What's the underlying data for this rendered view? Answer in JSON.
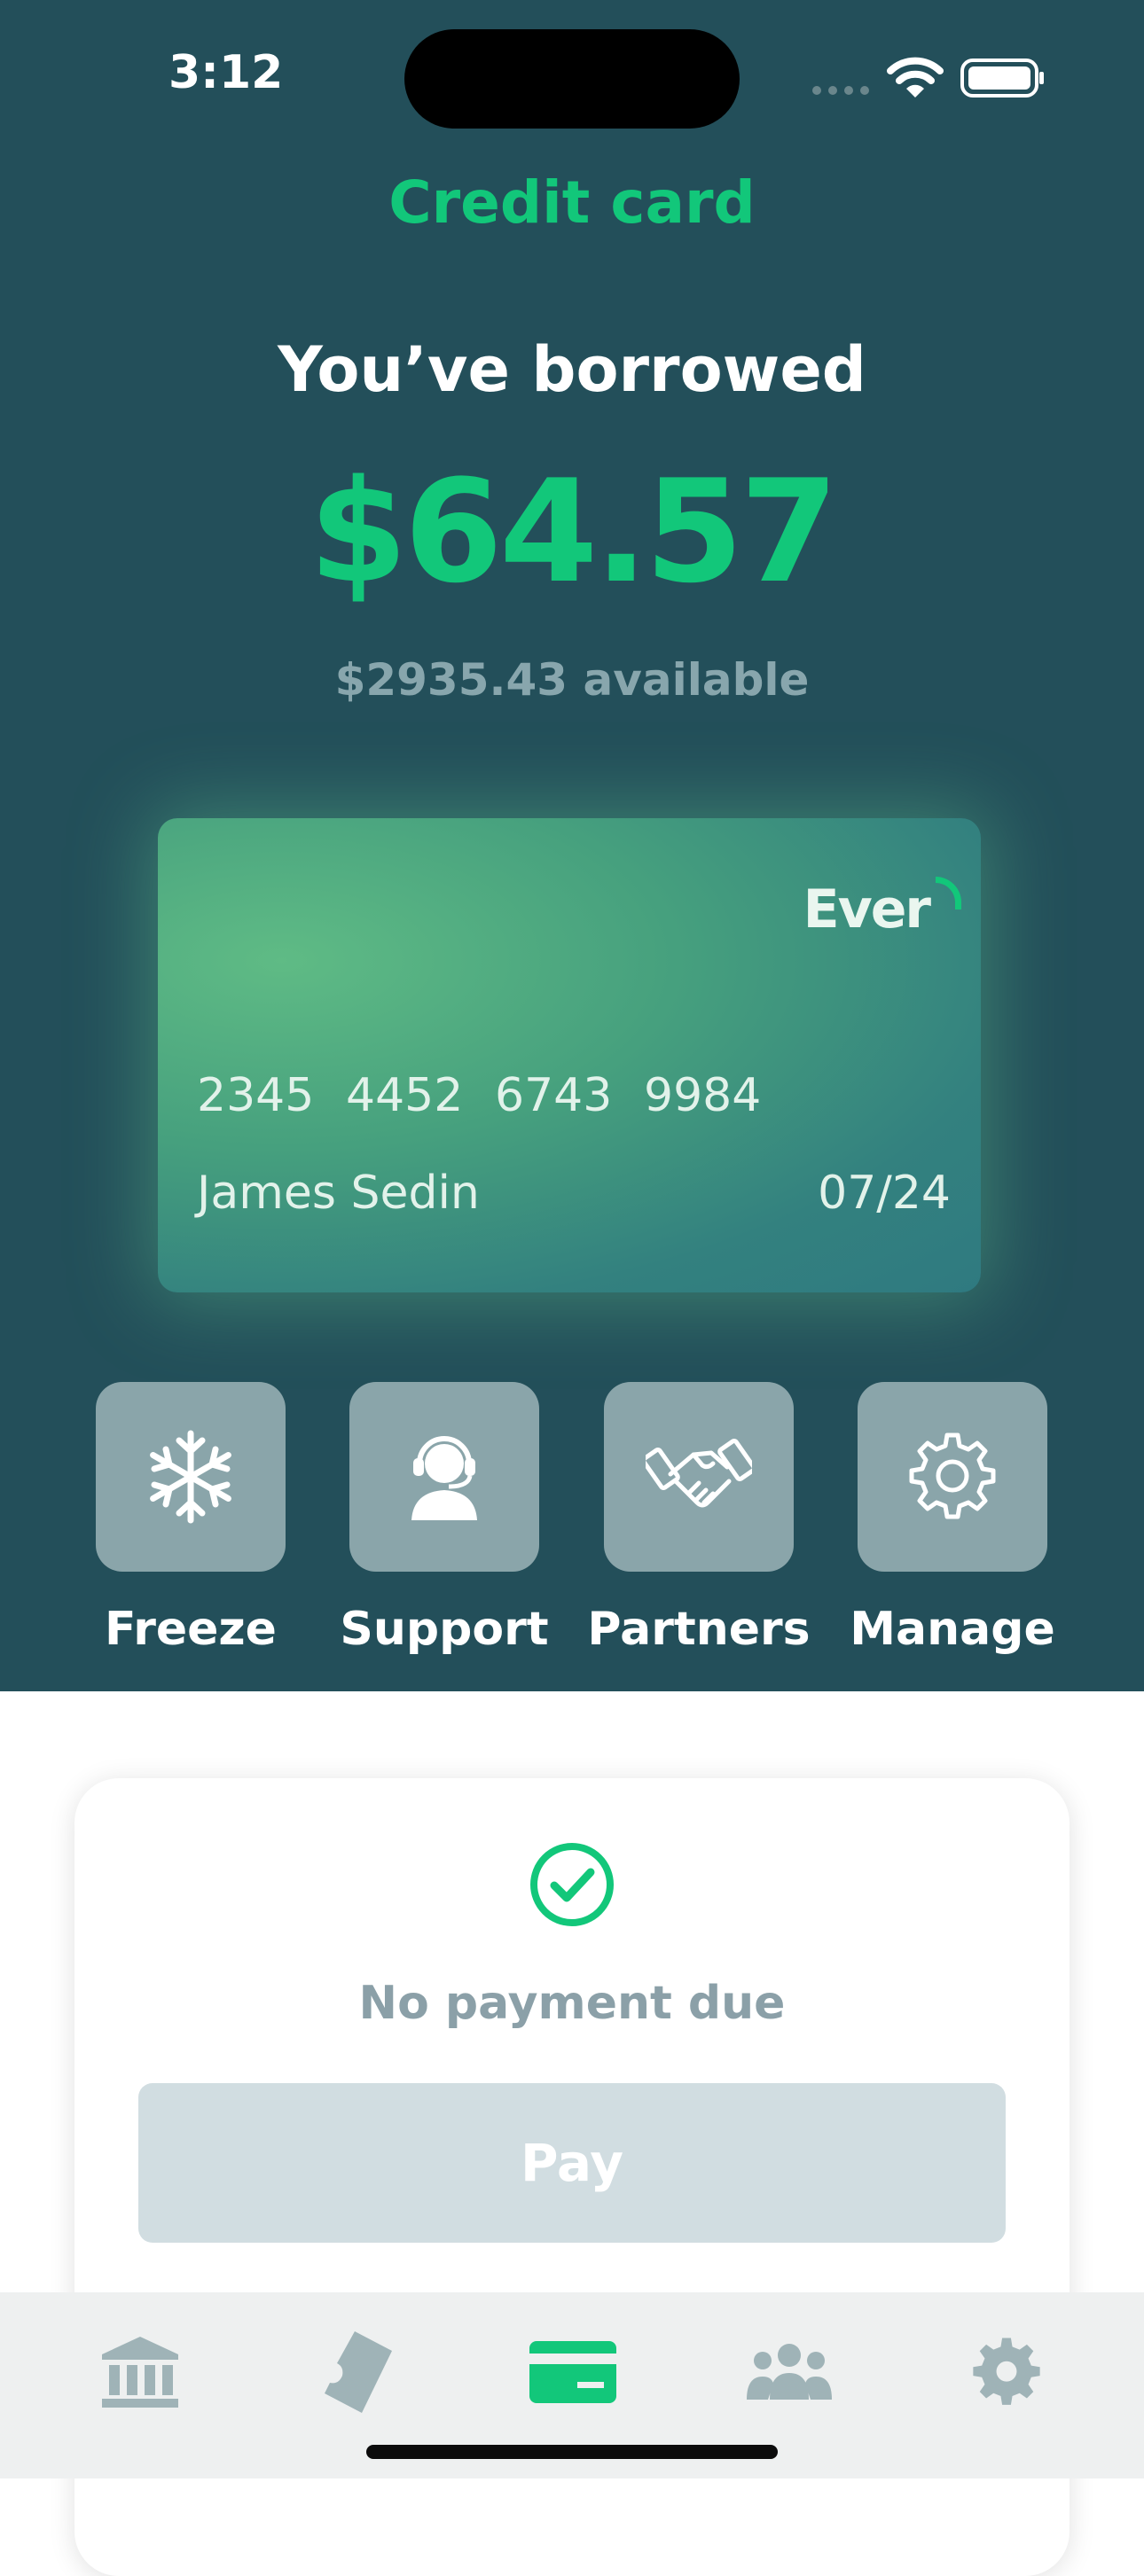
{
  "status_bar": {
    "time": "3:12"
  },
  "header": {
    "title": "Credit card"
  },
  "balance": {
    "heading": "You’ve borrowed",
    "amount": "$64.57",
    "available": "$2935.43 available"
  },
  "card": {
    "brand": "Ever",
    "number_groups": [
      "2345",
      "4452",
      "6743",
      "9984"
    ],
    "holder": "James Sedin",
    "expiry": "07/24"
  },
  "actions": [
    {
      "label": "Freeze",
      "icon": "snowflake-icon"
    },
    {
      "label": "Support",
      "icon": "headset-agent-icon"
    },
    {
      "label": "Partners",
      "icon": "handshake-icon"
    },
    {
      "label": "Manage",
      "icon": "gear-icon"
    }
  ],
  "payment": {
    "status_icon": "check-circle-icon",
    "status": "No payment due",
    "button": "Pay"
  },
  "tab_bar": {
    "items": [
      {
        "icon": "bank-icon",
        "active": false
      },
      {
        "icon": "ticket-icon",
        "active": false
      },
      {
        "icon": "credit-card-icon",
        "active": true
      },
      {
        "icon": "people-icon",
        "active": false
      },
      {
        "icon": "gear-icon",
        "active": false
      }
    ]
  },
  "colors": {
    "background_top": "#234f5a",
    "accent": "#12c77a",
    "action_tile": "#8aa5aa",
    "pay_disabled": "#d1dde1",
    "tab_inactive": "#9fb3b7"
  }
}
